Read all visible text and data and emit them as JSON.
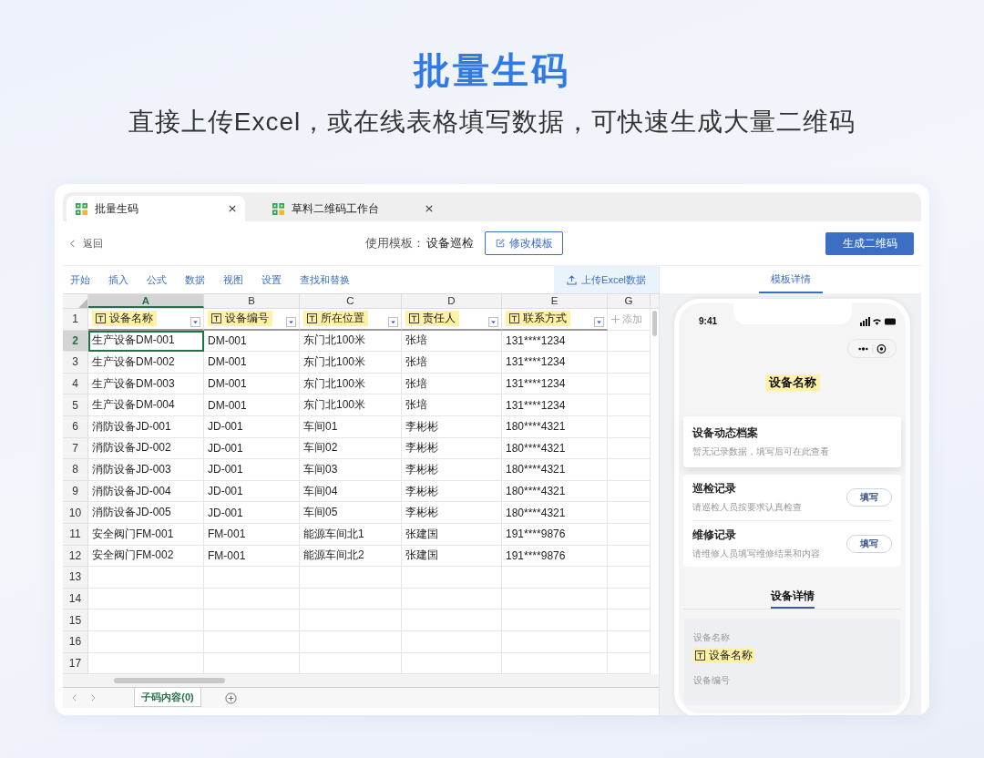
{
  "hero": {
    "title": "批量生码",
    "subtitle": "直接上传Excel，或在线表格填写数据，可快速生成大量二维码"
  },
  "tabs": [
    {
      "label": "批量生码",
      "selected": true
    },
    {
      "label": "草料二维码工作台",
      "selected": false
    }
  ],
  "toolbar": {
    "back": "返回",
    "template_label": "使用模板：",
    "template_value": "设备巡检",
    "edit_button": "修改模板",
    "generate_button": "生成二维码"
  },
  "menu": [
    "开始",
    "插入",
    "公式",
    "数据",
    "视图",
    "设置",
    "查找和替换"
  ],
  "upload_button": "上传Excel数据",
  "sheet": {
    "columns": [
      {
        "letter": "A",
        "selected": true
      },
      {
        "letter": "B",
        "selected": false
      },
      {
        "letter": "C",
        "selected": false
      },
      {
        "letter": "D",
        "selected": false
      },
      {
        "letter": "E",
        "selected": false
      },
      {
        "letter": "G",
        "selected": false
      }
    ],
    "headers": [
      "设备名称",
      "设备编号",
      "所在位置",
      "责任人",
      "联系方式"
    ],
    "add_column": "添加",
    "rows": [
      {
        "num": "2",
        "selected": true,
        "cells": [
          "生产设备DM-001",
          "DM-001",
          "东门北100米",
          "张培",
          "131****1234"
        ]
      },
      {
        "num": "3",
        "selected": false,
        "cells": [
          "生产设备DM-002",
          "DM-001",
          "东门北100米",
          "张培",
          "131****1234"
        ]
      },
      {
        "num": "4",
        "selected": false,
        "cells": [
          "生产设备DM-003",
          "DM-001",
          "东门北100米",
          "张培",
          "131****1234"
        ]
      },
      {
        "num": "5",
        "selected": false,
        "cells": [
          "生产设备DM-004",
          "DM-001",
          "东门北100米",
          "张培",
          "131****1234"
        ]
      },
      {
        "num": "6",
        "selected": false,
        "cells": [
          "消防设备JD-001",
          "JD-001",
          "车间01",
          "李彬彬",
          "180****4321"
        ]
      },
      {
        "num": "7",
        "selected": false,
        "cells": [
          "消防设备JD-002",
          "JD-001",
          "车间02",
          "李彬彬",
          "180****4321"
        ]
      },
      {
        "num": "8",
        "selected": false,
        "cells": [
          "消防设备JD-003",
          "JD-001",
          "车间03",
          "李彬彬",
          "180****4321"
        ]
      },
      {
        "num": "9",
        "selected": false,
        "cells": [
          "消防设备JD-004",
          "JD-001",
          "车间04",
          "李彬彬",
          "180****4321"
        ]
      },
      {
        "num": "10",
        "selected": false,
        "cells": [
          "消防设备JD-005",
          "JD-001",
          "车间05",
          "李彬彬",
          "180****4321"
        ]
      },
      {
        "num": "11",
        "selected": false,
        "cells": [
          "安全阀门FM-001",
          "FM-001",
          "能源车间北1",
          "张建国",
          "191****9876"
        ]
      },
      {
        "num": "12",
        "selected": false,
        "cells": [
          "安全阀门FM-002",
          "FM-001",
          "能源车间北2",
          "张建国",
          "191****9876"
        ]
      },
      {
        "num": "13",
        "selected": false,
        "cells": []
      },
      {
        "num": "14",
        "selected": false,
        "cells": []
      },
      {
        "num": "15",
        "selected": false,
        "cells": []
      },
      {
        "num": "16",
        "selected": false,
        "cells": []
      },
      {
        "num": "17",
        "selected": false,
        "cells": []
      }
    ],
    "header_row_num": "1",
    "sheet_tab": "子码内容(0)"
  },
  "panel": {
    "tab": "模板详情",
    "phone": {
      "time": "9:41",
      "title": "设备名称",
      "archive": {
        "title": "设备动态档案",
        "desc": "暂无记录数据，填写后可在此查看"
      },
      "records": [
        {
          "title": "巡检记录",
          "desc": "请巡检人员按要求认真检查",
          "button": "填写"
        },
        {
          "title": "维修记录",
          "desc": "请维修人员填写维修结果和内容",
          "button": "填写"
        }
      ],
      "section": "设备详情",
      "fields": [
        {
          "label": "设备名称",
          "value": "设备名称"
        },
        {
          "label": "设备编号"
        }
      ]
    }
  }
}
